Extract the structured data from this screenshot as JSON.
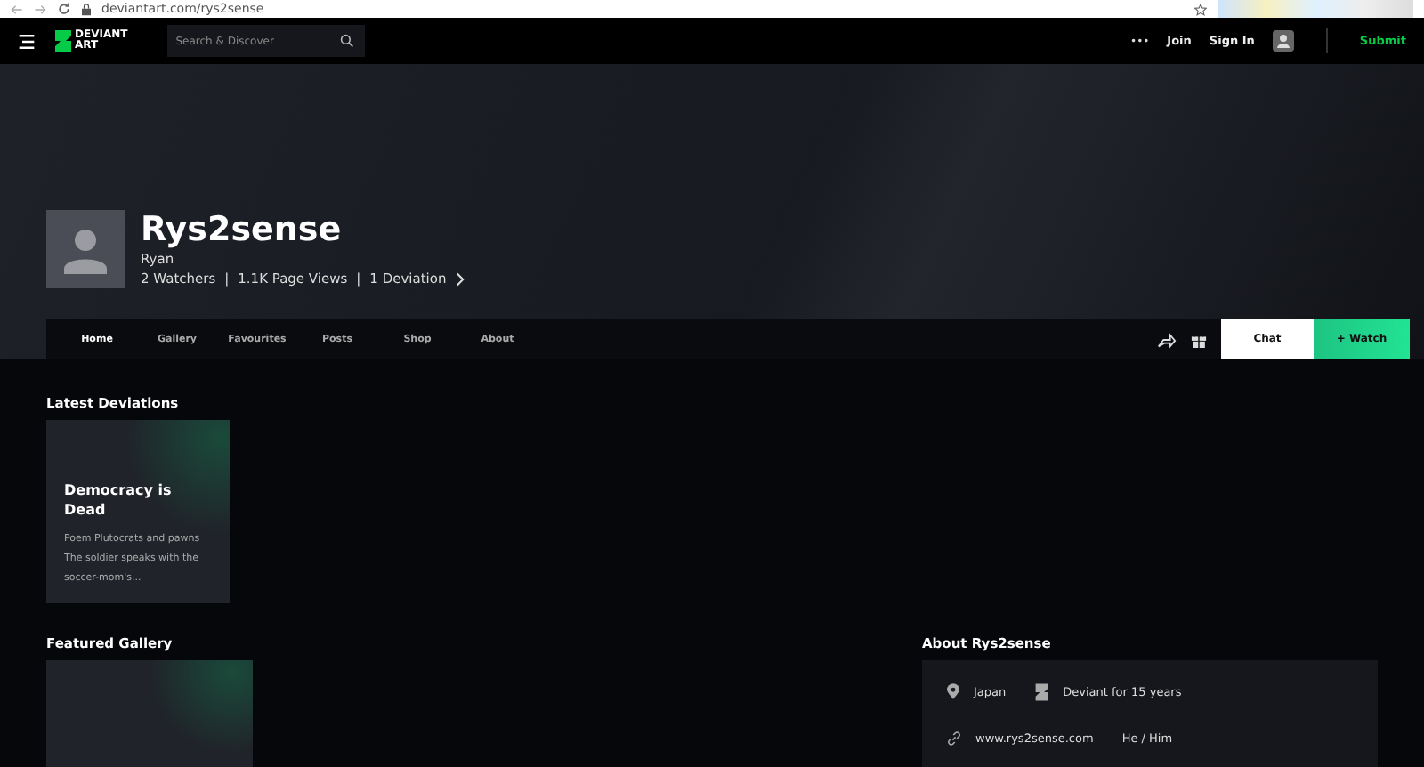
{
  "browser": {
    "url": "deviantart.com/rys2sense"
  },
  "navbar": {
    "logo": [
      "DEVIANT",
      "ART"
    ],
    "search": {
      "placeholder": "Search & Discover"
    },
    "more": "•••",
    "links": [
      "Join",
      "Sign In"
    ],
    "submit": "Submit"
  },
  "profile": {
    "name": "Rys2sense",
    "real_name": "Ryan",
    "stats": [
      "2 Watchers",
      "1.1K Page Views",
      "1 Deviation"
    ],
    "separator": "|"
  },
  "tabs": [
    {
      "label": "Home",
      "selected": true
    },
    {
      "label": "Gallery",
      "selected": false
    },
    {
      "label": "Favourites",
      "selected": false
    },
    {
      "label": "Posts",
      "selected": false
    },
    {
      "label": "Shop",
      "selected": false
    },
    {
      "label": "About",
      "selected": false
    }
  ],
  "actions": {
    "chat": "Chat",
    "watch": "+ Watch"
  },
  "latest": {
    "title": "Latest Deviations",
    "cards": [
      {
        "title": "Democracy is Dead",
        "excerpt": "Poem Plutocrats and pawns The soldier speaks with the soccer-mom's..."
      }
    ]
  },
  "featured": {
    "title": "Featured Gallery"
  },
  "about": {
    "title": "About Rys2sense",
    "items": [
      {
        "kind": "location",
        "text": "Japan"
      },
      {
        "kind": "deviant",
        "text": "Deviant for 15 years"
      },
      {
        "kind": "link",
        "text": "www.rys2sense.com"
      },
      {
        "kind": "plain",
        "text": "He / Him"
      }
    ]
  }
}
